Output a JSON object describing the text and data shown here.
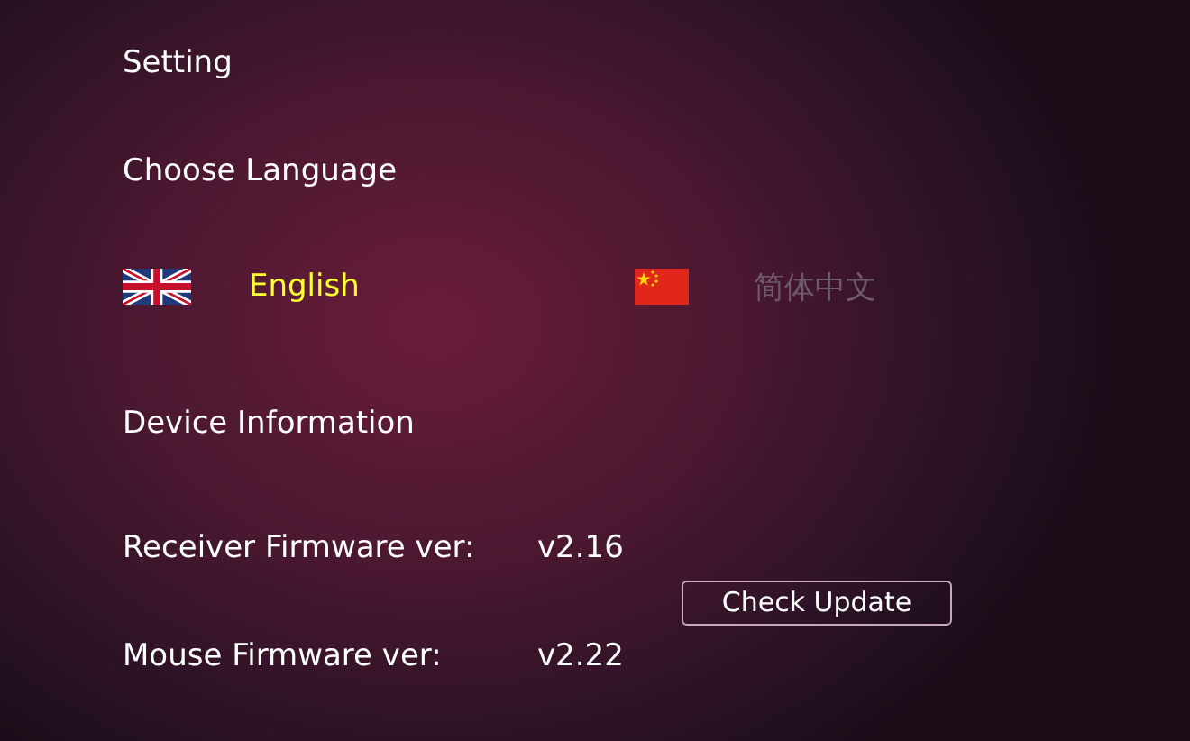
{
  "title": "Setting",
  "language_section": {
    "heading": "Choose Language",
    "options": [
      {
        "kind": "uk",
        "label": "English",
        "selected": true
      },
      {
        "kind": "cn",
        "label": "简体中文",
        "selected": false
      }
    ]
  },
  "device_section": {
    "heading": "Device Information",
    "rows": [
      {
        "label": "Receiver Firmware ver:",
        "value": "v2.16"
      },
      {
        "label": "Mouse Firmware ver:",
        "value": "v2.22"
      }
    ],
    "button": "Check Update"
  }
}
